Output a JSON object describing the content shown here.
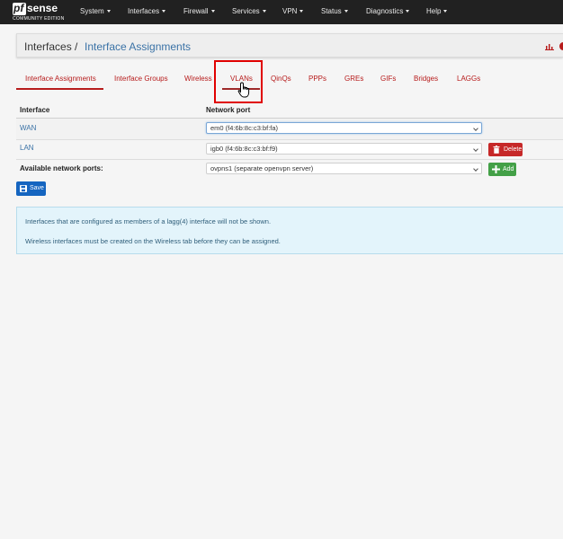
{
  "brand": {
    "pf": "pf",
    "sense": "sense",
    "edition": "COMMUNITY EDITION"
  },
  "navbar": {
    "items": [
      {
        "label": "System"
      },
      {
        "label": "Interfaces"
      },
      {
        "label": "Firewall"
      },
      {
        "label": "Services"
      },
      {
        "label": "VPN"
      },
      {
        "label": "Status"
      },
      {
        "label": "Diagnostics"
      },
      {
        "label": "Help"
      }
    ]
  },
  "breadcrumb": {
    "section": "Interfaces",
    "separator": "/",
    "page": "Interface Assignments"
  },
  "tabs": [
    {
      "label": "Interface Assignments",
      "active": true
    },
    {
      "label": "Interface Groups"
    },
    {
      "label": "Wireless"
    },
    {
      "label": "VLANs",
      "hovered": true
    },
    {
      "label": "QinQs"
    },
    {
      "label": "PPPs"
    },
    {
      "label": "GREs"
    },
    {
      "label": "GIFs"
    },
    {
      "label": "Bridges"
    },
    {
      "label": "LAGGs"
    }
  ],
  "table": {
    "headers": {
      "interface": "Interface",
      "port": "Network port"
    },
    "rows": [
      {
        "interface": "WAN",
        "port": "em0 (f4:6b:8c:c3:bf:fa)"
      },
      {
        "interface": "LAN",
        "port": "igb0 (f4:6b:8c:c3:bf:f9)",
        "action": "Delete"
      }
    ],
    "available": {
      "label": "Available network ports:",
      "port": "ovpns1 (separate openvpn server)",
      "action": "Add"
    }
  },
  "save": {
    "label": "Save"
  },
  "info": {
    "line1": "Interfaces that are configured as members of a lagg(4) interface will not be shown.",
    "line2": "Wireless interfaces must be created on the Wireless tab before they can be assigned."
  },
  "colors": {
    "navbar": "#212121",
    "accent_red": "#b71c1c",
    "link_blue": "#3a72a6",
    "save_blue": "#1565c0",
    "add_green": "#43a047",
    "delete_red": "#c62828",
    "info_bg": "#e3f4fb"
  },
  "icons": {
    "chart": "bar-chart-icon",
    "help": "help-icon",
    "save": "save-icon",
    "delete": "trash-icon",
    "add": "plus-icon",
    "cursor": "hand-cursor-icon"
  }
}
